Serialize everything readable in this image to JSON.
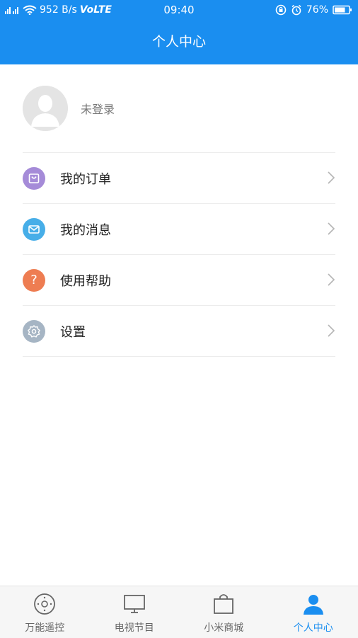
{
  "status_bar": {
    "net_speed": "952 B/s",
    "volte": "VoLTE",
    "time": "09:40",
    "battery": "76%"
  },
  "header": {
    "title": "个人中心"
  },
  "profile": {
    "login_status": "未登录"
  },
  "menu": {
    "items": [
      {
        "label": "我的订单",
        "icon": "shopping-bag-icon",
        "color": "#a58bd8"
      },
      {
        "label": "我的消息",
        "icon": "mail-icon",
        "color": "#47aee8"
      },
      {
        "label": "使用帮助",
        "icon": "help-icon",
        "color": "#ee7d52"
      },
      {
        "label": "设置",
        "icon": "settings-icon",
        "color": "#a6b5c4"
      }
    ]
  },
  "tab_bar": {
    "tabs": [
      {
        "label": "万能遥控",
        "icon": "remote-icon",
        "active": false
      },
      {
        "label": "电视节目",
        "icon": "tv-icon",
        "active": false
      },
      {
        "label": "小米商城",
        "icon": "shopping-bag-icon",
        "active": false
      },
      {
        "label": "个人中心",
        "icon": "person-icon",
        "active": true
      }
    ]
  },
  "colors": {
    "accent": "#1a8ef0",
    "inactive": "#666666"
  }
}
